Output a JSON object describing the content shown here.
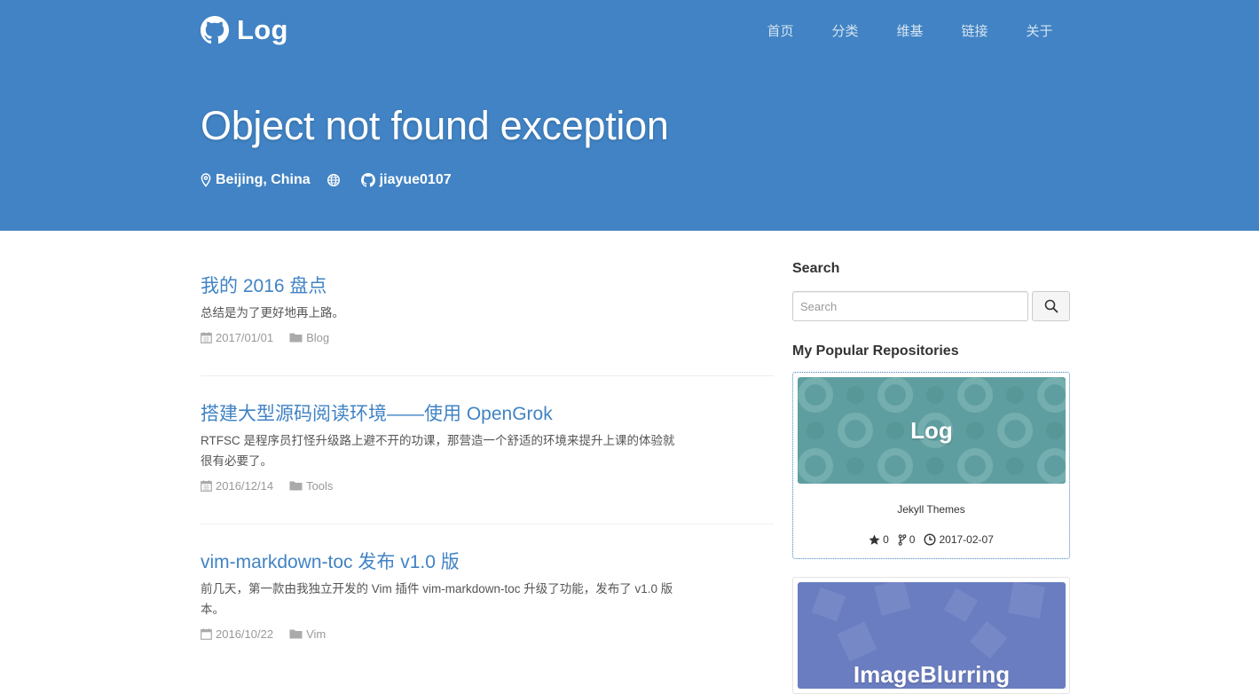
{
  "brand": {
    "name": "Log",
    "icon": "github-icon"
  },
  "nav": [
    {
      "label": "首页"
    },
    {
      "label": "分类"
    },
    {
      "label": "维基"
    },
    {
      "label": "链接"
    },
    {
      "label": "关于"
    }
  ],
  "hero": {
    "title": "Object not found exception",
    "location": "Beijing, China",
    "location_icon": "map-marker-icon",
    "globe_icon": "globe-icon",
    "github_user": "jiayue0107",
    "github_icon": "github-icon"
  },
  "posts": [
    {
      "title": "我的 2016 盘点",
      "excerpt": "总结是为了更好地再上路。",
      "date": "2017/01/01",
      "category": "Blog"
    },
    {
      "title": "搭建大型源码阅读环境——使用 OpenGrok",
      "excerpt": "RTFSC 是程序员打怪升级路上避不开的功课，那营造一个舒适的环境来提升上课的体验就很有必要了。",
      "date": "2016/12/14",
      "category": "Tools"
    },
    {
      "title": "vim-markdown-toc 发布 v1.0 版",
      "excerpt": "前几天，第一款由我独立开发的 Vim 插件 vim-markdown-toc 升级了功能，发布了 v1.0 版本。",
      "date": "2016/10/22",
      "category": "Vim"
    }
  ],
  "sidebar": {
    "search_heading": "Search",
    "search_placeholder": "Search",
    "repos_heading": "My Popular Repositories",
    "repos": [
      {
        "name": "Log",
        "description": "Jekyll Themes",
        "stars": "0",
        "forks": "0",
        "updated": "2017-02-07",
        "color": "#5f9ea0"
      },
      {
        "name": "ImageBlurring",
        "color": "#6a7dc0"
      }
    ]
  },
  "colors": {
    "header": "#4183c4",
    "link": "#4183c4",
    "muted": "#999999"
  }
}
